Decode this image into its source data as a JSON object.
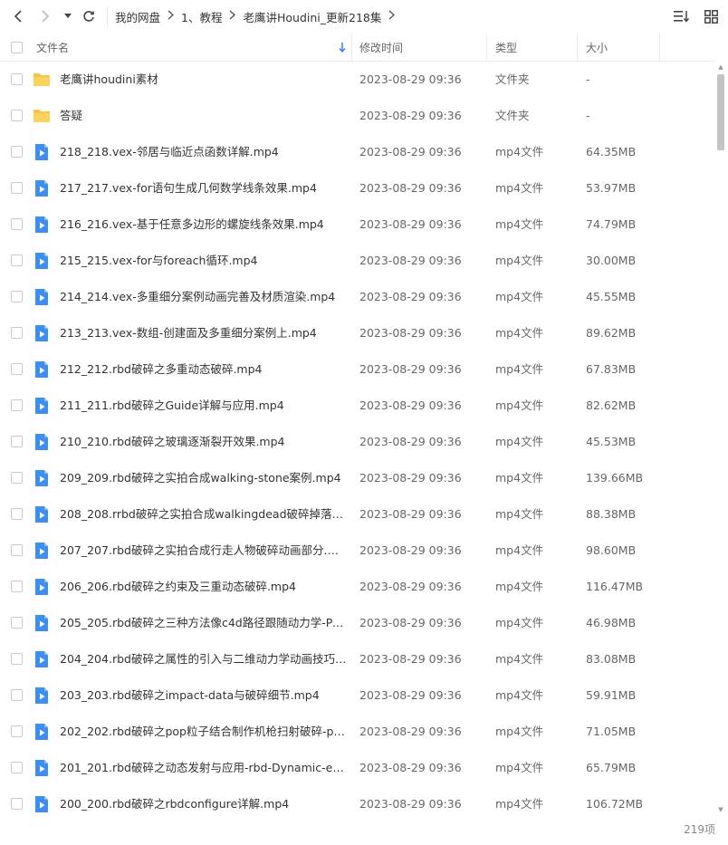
{
  "breadcrumb": [
    "我的网盘",
    "1、教程",
    "老鹰讲Houdini_更新218集"
  ],
  "columns": {
    "name": "文件名",
    "time": "修改时间",
    "type": "类型",
    "size": "大小"
  },
  "colors": {
    "accent": "#3a86f5",
    "folder": "#f8c646",
    "video": "#3d8ef2"
  },
  "files": [
    {
      "kind": "folder",
      "name": "老鹰讲houdini素材",
      "time": "2023-08-29 09:36",
      "type": "文件夹",
      "size": "-"
    },
    {
      "kind": "folder",
      "name": "答疑",
      "time": "2023-08-29 09:36",
      "type": "文件夹",
      "size": "-"
    },
    {
      "kind": "video",
      "name": "218_218.vex-邻居与临近点函数详解.mp4",
      "time": "2023-08-29 09:36",
      "type": "mp4文件",
      "size": "64.35MB"
    },
    {
      "kind": "video",
      "name": "217_217.vex-for语句生成几何数学线条效果.mp4",
      "time": "2023-08-29 09:36",
      "type": "mp4文件",
      "size": "53.97MB"
    },
    {
      "kind": "video",
      "name": "216_216.vex-基于任意多边形的螺旋线条效果.mp4",
      "time": "2023-08-29 09:36",
      "type": "mp4文件",
      "size": "74.79MB"
    },
    {
      "kind": "video",
      "name": "215_215.vex-for与foreach循环.mp4",
      "time": "2023-08-29 09:36",
      "type": "mp4文件",
      "size": "30.00MB"
    },
    {
      "kind": "video",
      "name": "214_214.vex-多重细分案例动画完善及材质渲染.mp4",
      "time": "2023-08-29 09:36",
      "type": "mp4文件",
      "size": "45.55MB"
    },
    {
      "kind": "video",
      "name": "213_213.vex-数组-创建面及多重细分案例上.mp4",
      "time": "2023-08-29 09:36",
      "type": "mp4文件",
      "size": "89.62MB"
    },
    {
      "kind": "video",
      "name": "212_212.rbd破碎之多重动态破碎.mp4",
      "time": "2023-08-29 09:36",
      "type": "mp4文件",
      "size": "67.83MB"
    },
    {
      "kind": "video",
      "name": "211_211.rbd破碎之Guide详解与应用.mp4",
      "time": "2023-08-29 09:36",
      "type": "mp4文件",
      "size": "82.62MB"
    },
    {
      "kind": "video",
      "name": "210_210.rbd破碎之玻璃逐渐裂开效果.mp4",
      "time": "2023-08-29 09:36",
      "type": "mp4文件",
      "size": "45.53MB"
    },
    {
      "kind": "video",
      "name": "209_209.rbd破碎之实拍合成walking-stone案例.mp4",
      "time": "2023-08-29 09:36",
      "type": "mp4文件",
      "size": "139.66MB"
    },
    {
      "kind": "video",
      "name": "208_208.rrbd破碎之实拍合成walkingdead破碎掉落粒...",
      "time": "2023-08-29 09:36",
      "type": "mp4文件",
      "size": "88.38MB"
    },
    {
      "kind": "video",
      "name": "207_207.rbd破碎之实拍合成行走人物破碎动画部分.mp4",
      "time": "2023-08-29 09:36",
      "type": "mp4文件",
      "size": "98.60MB"
    },
    {
      "kind": "video",
      "name": "206_206.rbd破碎之约束及三重动态破碎.mp4",
      "time": "2023-08-29 09:36",
      "type": "mp4文件",
      "size": "116.47MB"
    },
    {
      "kind": "video",
      "name": "205_205.rbd破碎之三种方法像c4d路径跟随动力学-Path...",
      "time": "2023-08-29 09:36",
      "type": "mp4文件",
      "size": "46.98MB"
    },
    {
      "kind": "video",
      "name": "204_204.rbd破碎之属性的引入与二维动力学动画技巧-r...",
      "time": "2023-08-29 09:36",
      "type": "mp4文件",
      "size": "83.08MB"
    },
    {
      "kind": "video",
      "name": "203_203.rbd破碎之impact-data与破碎细节.mp4",
      "time": "2023-08-29 09:36",
      "type": "mp4文件",
      "size": "59.91MB"
    },
    {
      "kind": "video",
      "name": "202_202.rbd破碎之pop粒子结合制作机枪扫射破碎-pop...",
      "time": "2023-08-29 09:36",
      "type": "mp4文件",
      "size": "71.05MB"
    },
    {
      "kind": "video",
      "name": "201_201.rbd破碎之动态发射与应用-rbd-Dynamic-emis...",
      "time": "2023-08-29 09:36",
      "type": "mp4文件",
      "size": "65.79MB"
    },
    {
      "kind": "video",
      "name": "200_200.rbd破碎之rbdconfigure详解.mp4",
      "time": "2023-08-29 09:36",
      "type": "mp4文件",
      "size": "106.72MB"
    }
  ],
  "footer": {
    "count": "219项"
  }
}
